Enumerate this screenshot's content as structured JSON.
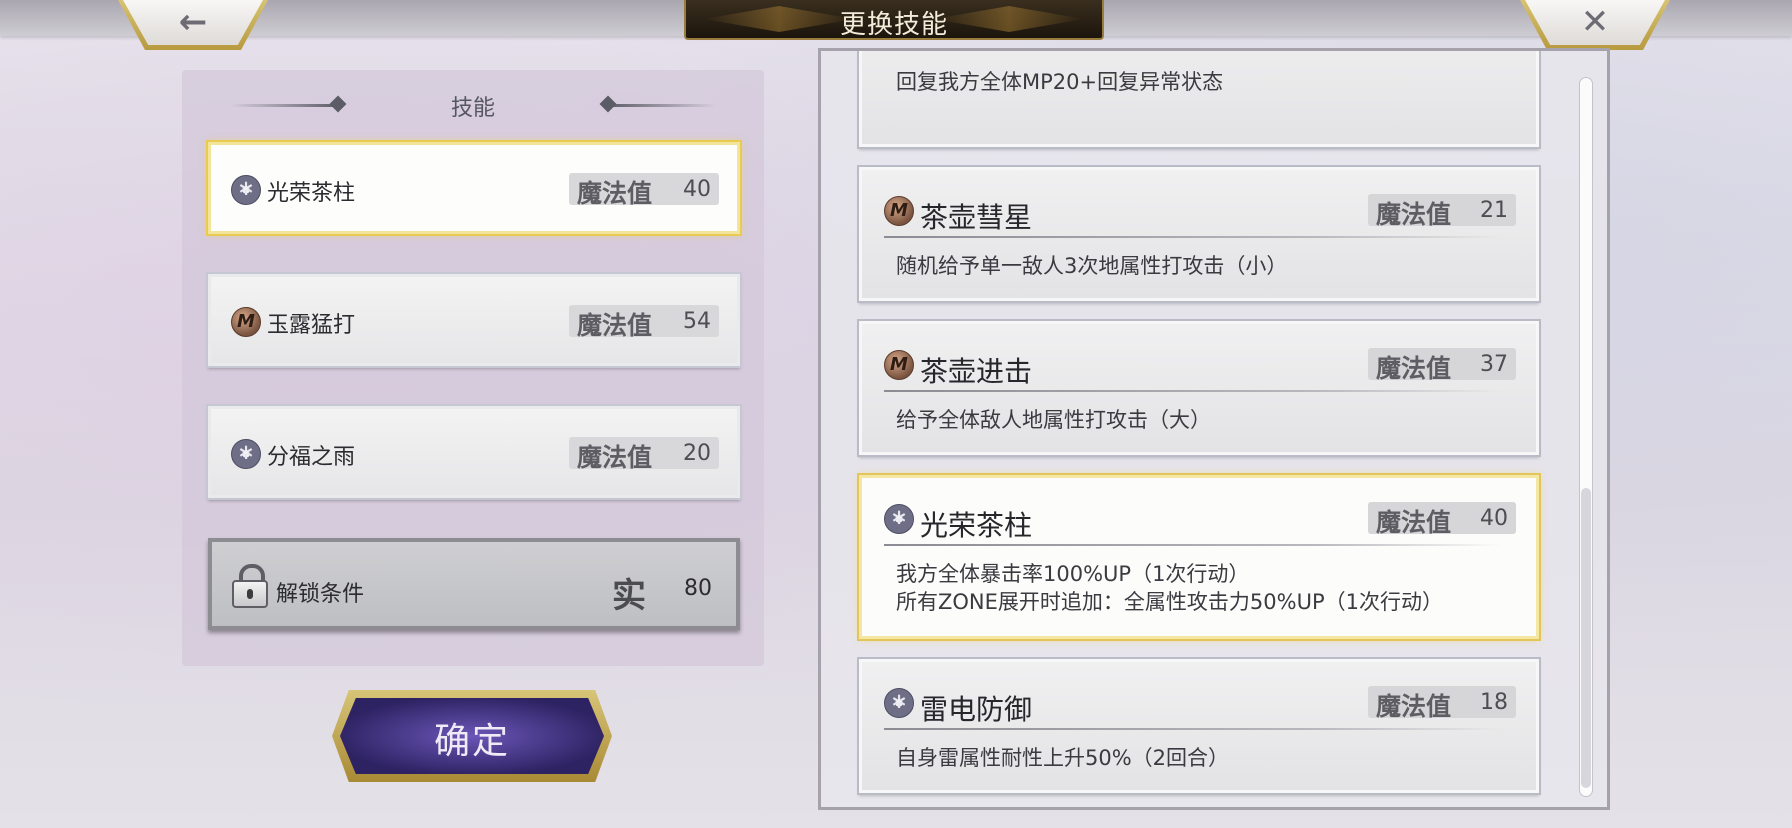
{
  "title": "更换技能",
  "nav": {
    "back_glyph": "←",
    "close_glyph": "✕"
  },
  "left_panel": {
    "header": "技能",
    "slots": [
      {
        "name": "光荣茶柱",
        "mp_label": "魔法值",
        "mp": "40",
        "icon": "star-element-icon",
        "selected": true
      },
      {
        "name": "玉露猛打",
        "mp_label": "魔法值",
        "mp": "54",
        "icon": "earth-element-icon",
        "selected": false
      },
      {
        "name": "分福之雨",
        "mp_label": "魔法值",
        "mp": "20",
        "icon": "star-element-icon",
        "selected": false
      }
    ],
    "locked_slot": {
      "label": "解锁条件",
      "mark": "实",
      "value": "80",
      "icon": "lock-icon"
    },
    "confirm_label": "确定"
  },
  "skill_list": {
    "cards": [
      {
        "name": "",
        "mp_label": "",
        "mp": "",
        "desc": "回复我方全体MP20+回复异常状态",
        "partial": true
      },
      {
        "name": "茶壶彗星",
        "mp_label": "魔法值",
        "mp": "21",
        "icon": "earth-element-icon",
        "desc": "随机给予单一敌人3次地属性打攻击（小）"
      },
      {
        "name": "茶壶进击",
        "mp_label": "魔法值",
        "mp": "37",
        "icon": "earth-element-icon",
        "desc": "给予全体敌人地属性打攻击（大）"
      },
      {
        "name": "光荣茶柱",
        "mp_label": "魔法值",
        "mp": "40",
        "icon": "star-element-icon",
        "selected": true,
        "desc": "我方全体暴击率100%UP（1次行动）\n所有ZONE展开时追加：全属性攻击力50%UP（1次行动）"
      },
      {
        "name": "雷电防御",
        "mp_label": "魔法值",
        "mp": "18",
        "icon": "star-element-icon",
        "desc": "自身雷属性耐性上升50%（2回合）"
      }
    ]
  },
  "colors": {
    "selected_border": "#e9cb53",
    "confirm_bg": "#3a2d7a",
    "gold_trim": "#c4a64e"
  }
}
